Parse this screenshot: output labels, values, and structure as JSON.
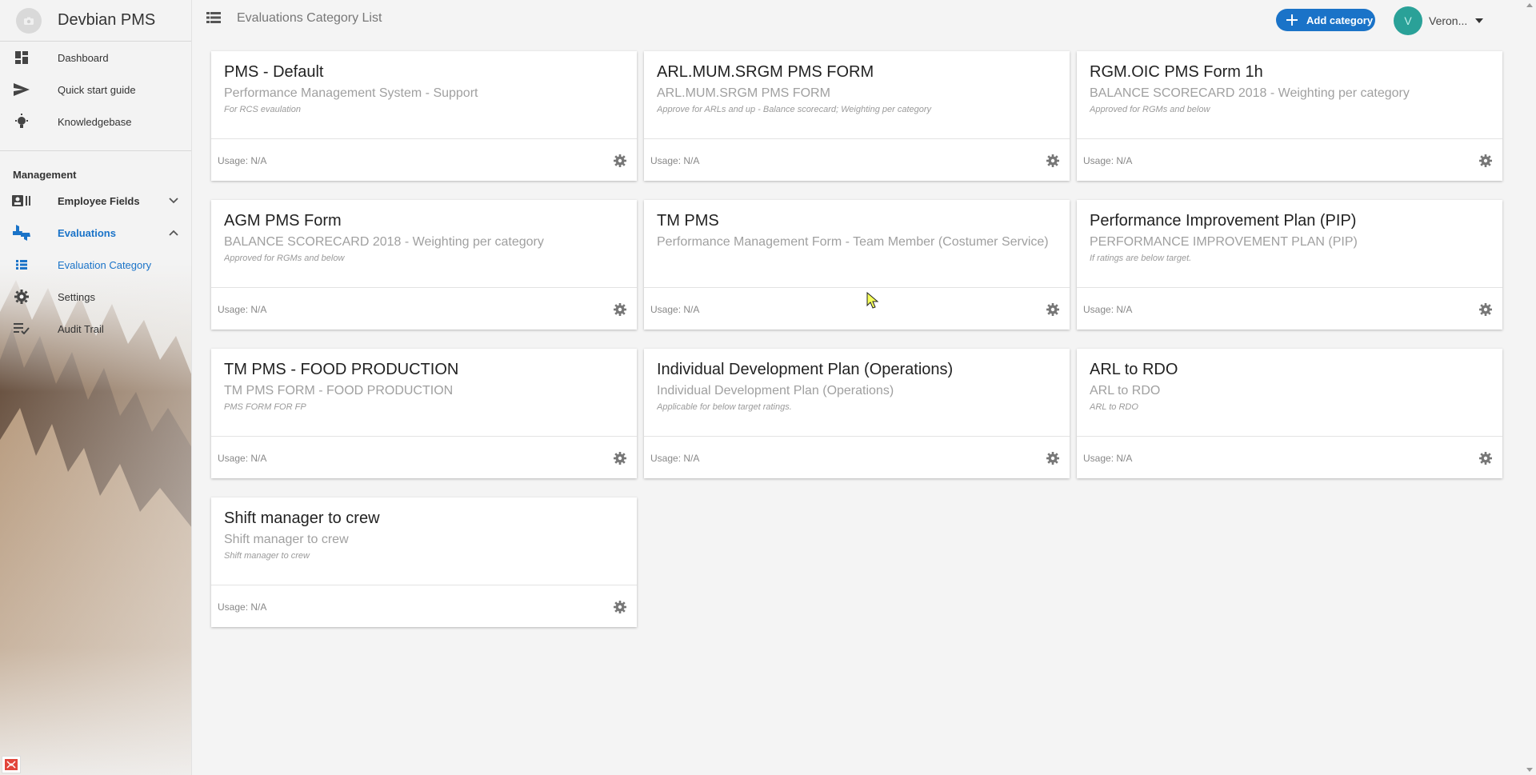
{
  "app": {
    "title": "Devbian PMS"
  },
  "sidebar": {
    "top_items": [
      {
        "label": "Dashboard",
        "icon": "dashboard-icon"
      },
      {
        "label": "Quick start guide",
        "icon": "send-icon"
      },
      {
        "label": "Knowledgebase",
        "icon": "bulb-icon"
      }
    ],
    "section_title": "Management",
    "mgmt_items": [
      {
        "label": "Employee Fields",
        "icon": "id-card-icon"
      },
      {
        "label": "Evaluations",
        "icon": "thumbs-icon"
      },
      {
        "label": "Evaluation Category",
        "icon": "list-icon"
      },
      {
        "label": "Settings",
        "icon": "gear-icon"
      },
      {
        "label": "Audit Trail",
        "icon": "checklist-icon"
      }
    ]
  },
  "header": {
    "title": "Evaluations Category List",
    "add_label": "Add category",
    "user_initial": "V",
    "user_name": "Veron..."
  },
  "cards": [
    {
      "title": "PMS - Default",
      "subtitle": "Performance Management System - Support",
      "desc": "For RCS evaulation",
      "usage": "Usage: N/A"
    },
    {
      "title": "ARL.MUM.SRGM PMS FORM",
      "subtitle": "ARL.MUM.SRGM PMS FORM",
      "desc": "Approve for ARLs and up - Balance scorecard; Weighting per category",
      "usage": "Usage: N/A"
    },
    {
      "title": "RGM.OIC PMS Form 1h",
      "subtitle": "BALANCE SCORECARD 2018 - Weighting per category",
      "desc": "Approved for RGMs and below",
      "usage": "Usage: N/A"
    },
    {
      "title": "AGM PMS Form",
      "subtitle": "BALANCE SCORECARD 2018 - Weighting per category",
      "desc": "Approved for RGMs and below",
      "usage": "Usage: N/A"
    },
    {
      "title": "TM PMS",
      "subtitle": "Performance Management Form - Team Member (Costumer Service)",
      "desc": "",
      "usage": "Usage: N/A"
    },
    {
      "title": "Performance Improvement Plan (PIP)",
      "subtitle": "PERFORMANCE IMPROVEMENT PLAN (PIP)",
      "desc": "If ratings are below target.",
      "usage": "Usage: N/A"
    },
    {
      "title": "TM PMS - FOOD PRODUCTION",
      "subtitle": "TM PMS FORM - FOOD PRODUCTION",
      "desc": "PMS FORM FOR FP",
      "usage": "Usage: N/A"
    },
    {
      "title": "Individual Development Plan (Operations)",
      "subtitle": "Individual Development Plan (Operations)",
      "desc": "Applicable for below target ratings.",
      "usage": "Usage: N/A"
    },
    {
      "title": "ARL to RDO",
      "subtitle": "ARL to RDO",
      "desc": "ARL to RDO",
      "usage": "Usage: N/A"
    },
    {
      "title": "Shift manager to crew",
      "subtitle": "Shift manager to crew",
      "desc": "Shift manager to crew",
      "usage": "Usage: N/A"
    }
  ],
  "colors": {
    "accent": "#1a73c8",
    "avatar": "#2aa198",
    "background": "#f4f4f4"
  }
}
